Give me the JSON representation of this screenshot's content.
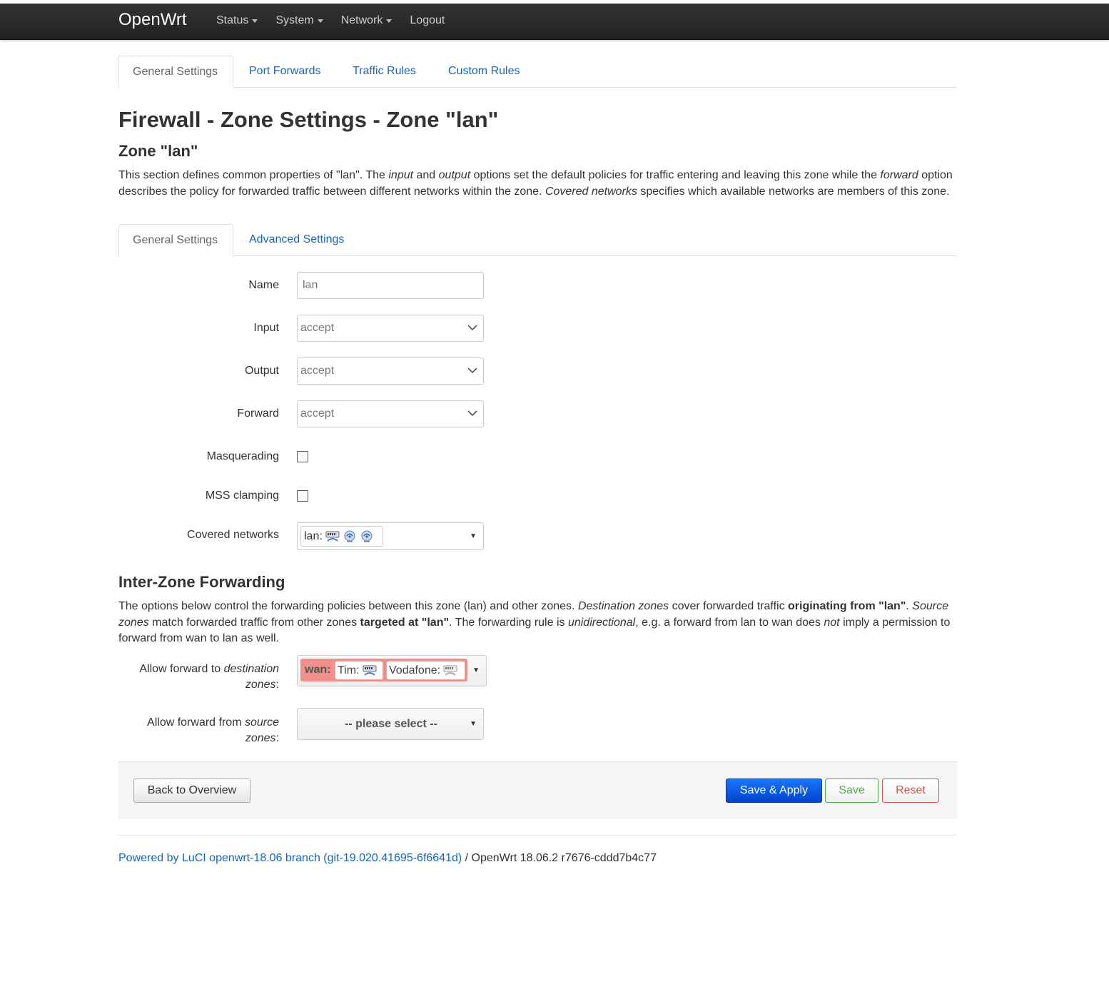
{
  "navbar": {
    "brand": "OpenWrt",
    "items": [
      {
        "label": "Status",
        "dropdown": true
      },
      {
        "label": "System",
        "dropdown": true
      },
      {
        "label": "Network",
        "dropdown": true
      },
      {
        "label": "Logout",
        "dropdown": false
      }
    ]
  },
  "top_tabs": [
    "General Settings",
    "Port Forwards",
    "Traffic Rules",
    "Custom Rules"
  ],
  "page_title": "Firewall - Zone Settings - Zone \"lan\"",
  "zone_section": {
    "heading": "Zone \"lan\"",
    "desc": {
      "p1": "This section defines common properties of \"lan\". The ",
      "input_em": "input",
      "p2": " and ",
      "output_em": "output",
      "p3": " options set the default policies for traffic entering and leaving this zone while the ",
      "forward_em": "forward",
      "p4": " option describes the policy for forwarded traffic between different networks within the zone. ",
      "covered_em": "Covered networks",
      "p5": " specifies which available networks are members of this zone."
    }
  },
  "sub_tabs": [
    "General Settings",
    "Advanced Settings"
  ],
  "form": {
    "name_label": "Name",
    "name_value": "lan",
    "input_label": "Input",
    "input_value": "accept",
    "output_label": "Output",
    "output_value": "accept",
    "forward_label": "Forward",
    "forward_value": "accept",
    "masquerading_label": "Masquerading",
    "mss_label": "MSS clamping",
    "covered_label": "Covered networks",
    "covered_chip": "lan:"
  },
  "interzone": {
    "heading": "Inter-Zone Forwarding",
    "desc": {
      "p1": "The options below control the forwarding policies between this zone (lan) and other zones. ",
      "dest_em": "Destination zones",
      "p2": " cover forwarded traffic ",
      "orig_strong": "originating from \"lan\"",
      "p3": ". ",
      "src_em": "Source zones",
      "p4": " match forwarded traffic from other zones ",
      "target_strong": "targeted at \"lan\"",
      "p5": ". The forwarding rule is ",
      "uni_em": "unidirectional",
      "p6": ", e.g. a forward from lan to wan does ",
      "not_em": "not",
      "p7": " imply a permission to forward from wan to lan as well."
    },
    "dest_label_a": "Allow forward to ",
    "dest_label_em": "destination",
    "dest_label_b": "zones",
    "dest_label_colon": ":",
    "dest_zone": "wan:",
    "dest_nets": [
      "Tim:",
      "Vodafone:"
    ],
    "src_label_a": "Allow forward from ",
    "src_label_em": "source",
    "src_label_b": "zones",
    "src_label_colon": ":",
    "src_placeholder": "-- please select --"
  },
  "actions": {
    "back": "Back to Overview",
    "save_apply": "Save & Apply",
    "save": "Save",
    "reset": "Reset"
  },
  "footer": {
    "link": "Powered by LuCI openwrt-18.06 branch (git-19.020.41695-6f6641d)",
    "rest": " / OpenWrt 18.06.2 r7676-cddd7b4c77"
  },
  "colors": {
    "link": "#1565c0",
    "navbar": "#222222",
    "apply": "#0055e0",
    "save": "#4cae4c",
    "reset": "#d9534f",
    "zone_wan": "#f0908c"
  }
}
